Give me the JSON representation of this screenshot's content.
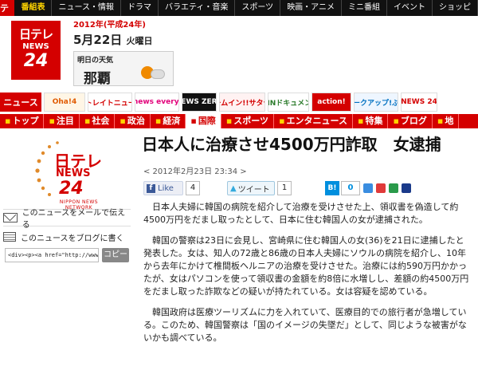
{
  "topnav": {
    "logo": "日テレ",
    "tabs": [
      "番組表",
      "ニュース・情報",
      "ドラマ",
      "バラエティ・音楽",
      "スポーツ",
      "映画・アニメ",
      "ミニ番組",
      "イベント",
      "ショッピ"
    ]
  },
  "header": {
    "logo_line1": "日テレ",
    "logo_line2": "NEWS",
    "logo_line3": "24",
    "date_year": "2012年(平成24年)",
    "date_main": "5月22日",
    "date_dow": "火曜日",
    "weather_label": "明日の天気",
    "weather_city": "那覇",
    "weather_icon": "sun-cloud-icon"
  },
  "banners": [
    "ニュース",
    "Oha!4",
    "ストレイトニュース",
    "news every.",
    "NEWS ZERO",
    "ズームイン!!サタデー",
    "NNNドキュメント",
    "action!",
    "ウェークアップ!ぷらす",
    "NEWS 24"
  ],
  "catnav": [
    "トップ",
    "注目",
    "社会",
    "政治",
    "経済",
    "国際",
    "スポーツ",
    "エンタニュース",
    "特集",
    "ブログ",
    "地"
  ],
  "sidebar": {
    "logo_line1": "日テレ",
    "logo_line2": "NEWS",
    "logo_line3": "24",
    "logo_sub": "NIPPON NEWS NETWORK",
    "mail_link": "このニュースをメールで伝える",
    "blog_link": "このニュースをブログに書く",
    "code_value": "<div><p><a href=\"http://www.r",
    "copy_button": "コピー"
  },
  "article": {
    "title": "日本人に治療させ4500万円詐取　女逮捕",
    "datetime": "< 2012年2月23日 23:34 >",
    "fb_like": "Like",
    "fb_count": "4",
    "tweet": "ツイート",
    "tweet_count": "1",
    "hatena": "B!",
    "hatena_count": "0",
    "paragraphs": [
      "日本人夫婦に韓国の病院を紹介して治療を受けさせた上、領収書を偽造して約4500万円をだまし取ったとして、日本に住む韓国人の女が逮捕された。",
      "韓国の警察は23日に会見し、宮崎県に住む韓国人の女(36)を21日に逮捕したと発表した。女は、知人の72歳と86歳の日本人夫婦にソウルの病院を紹介し、10年から去年にかけて椎間板ヘルニアの治療を受けさせた。治療には約590万円かかったが、女はパソコンを使って領収書の金額を約8倍に水増しし、差額の約4500万円をだまし取った詐欺などの疑いが持たれている。女は容疑を認めている。",
      "韓国政府は医療ツーリズムに力を入れていて、医療目的での旅行者が急増している。このため、韓国警察は「国のイメージの失墜だ」として、同じような被害がないかも調べている。"
    ]
  },
  "colors": {
    "brand_red": "#d40000",
    "accent_yellow": "#ffd400",
    "fb_blue": "#3b5998",
    "hatena_blue": "#008fde"
  }
}
